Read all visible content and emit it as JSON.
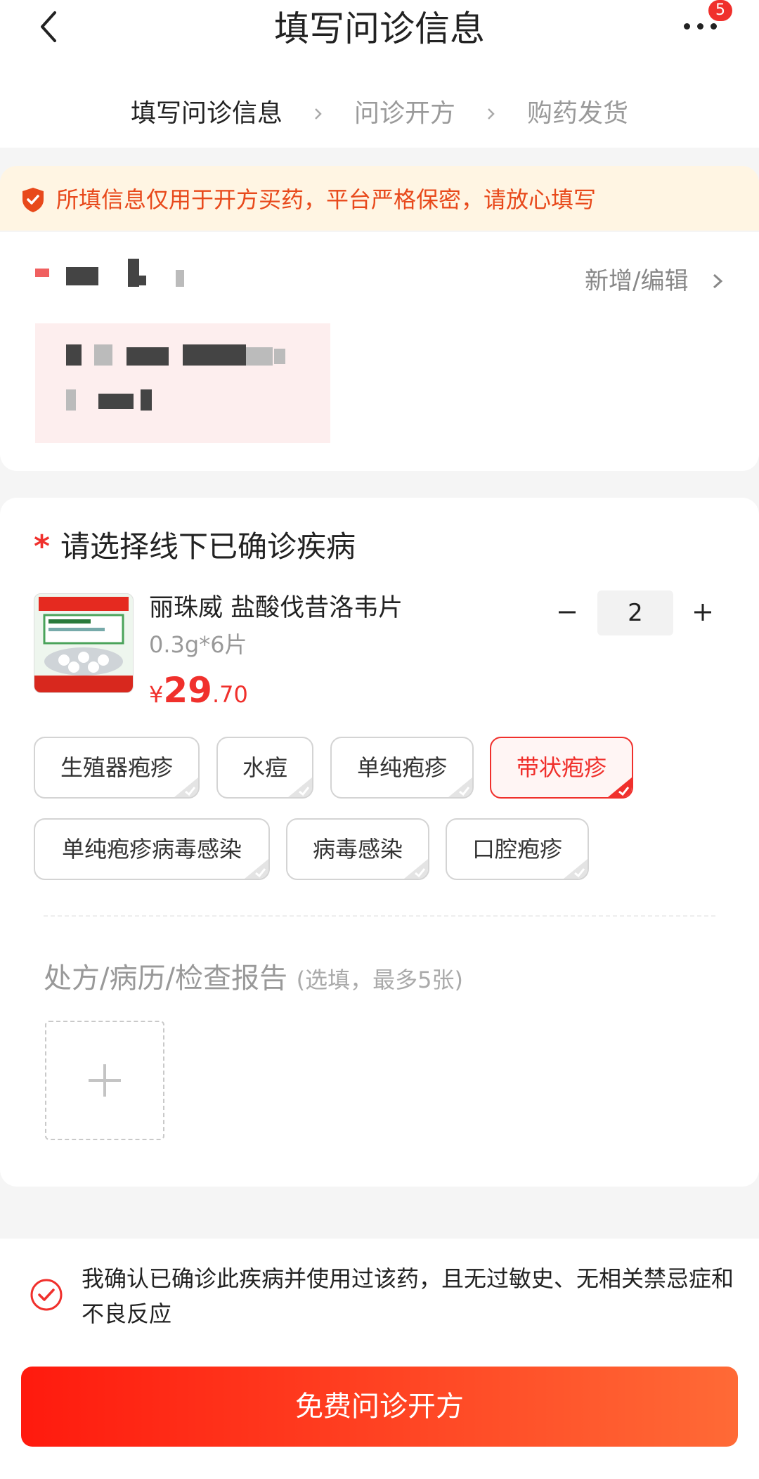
{
  "header": {
    "title": "填写问诊信息",
    "badge_count": "5",
    "steps": [
      {
        "label": "填写问诊信息",
        "state": "active"
      },
      {
        "label": "问诊开方",
        "state": "inactive"
      },
      {
        "label": "购药发货",
        "state": "inactive"
      }
    ]
  },
  "notice": {
    "text": "所填信息仅用于开方买药，平台严格保密，请放心填写"
  },
  "address": {
    "action_label": "新增/编辑"
  },
  "disease": {
    "required_mark": "*",
    "title": "请选择线下已确诊疾病",
    "product": {
      "name": "丽珠威 盐酸伐昔洛韦片",
      "spec": "0.3g*6片",
      "price_currency": "¥",
      "price_int": "29",
      "price_dec": ".70",
      "quantity": "2"
    },
    "tags": [
      {
        "label": "生殖器疱疹",
        "selected": false
      },
      {
        "label": "水痘",
        "selected": false
      },
      {
        "label": "单纯疱疹",
        "selected": false
      },
      {
        "label": "带状疱疹",
        "selected": true
      },
      {
        "label": "单纯疱疹病毒感染",
        "selected": false
      },
      {
        "label": "病毒感染",
        "selected": false
      },
      {
        "label": "口腔疱疹",
        "selected": false
      }
    ],
    "upload_title": "处方/病历/检查报告",
    "upload_hint": "(选填，最多5张)"
  },
  "footer": {
    "confirm_text": "我确认已确诊此疾病并使用过该药，且无过敏史、无相关禁忌症和不良反应",
    "confirm_checked": true,
    "submit_label": "免费问诊开方"
  },
  "colors": {
    "accent": "#f0302c",
    "notice_bg": "#fff5e3",
    "notice_text": "#e8491b"
  }
}
